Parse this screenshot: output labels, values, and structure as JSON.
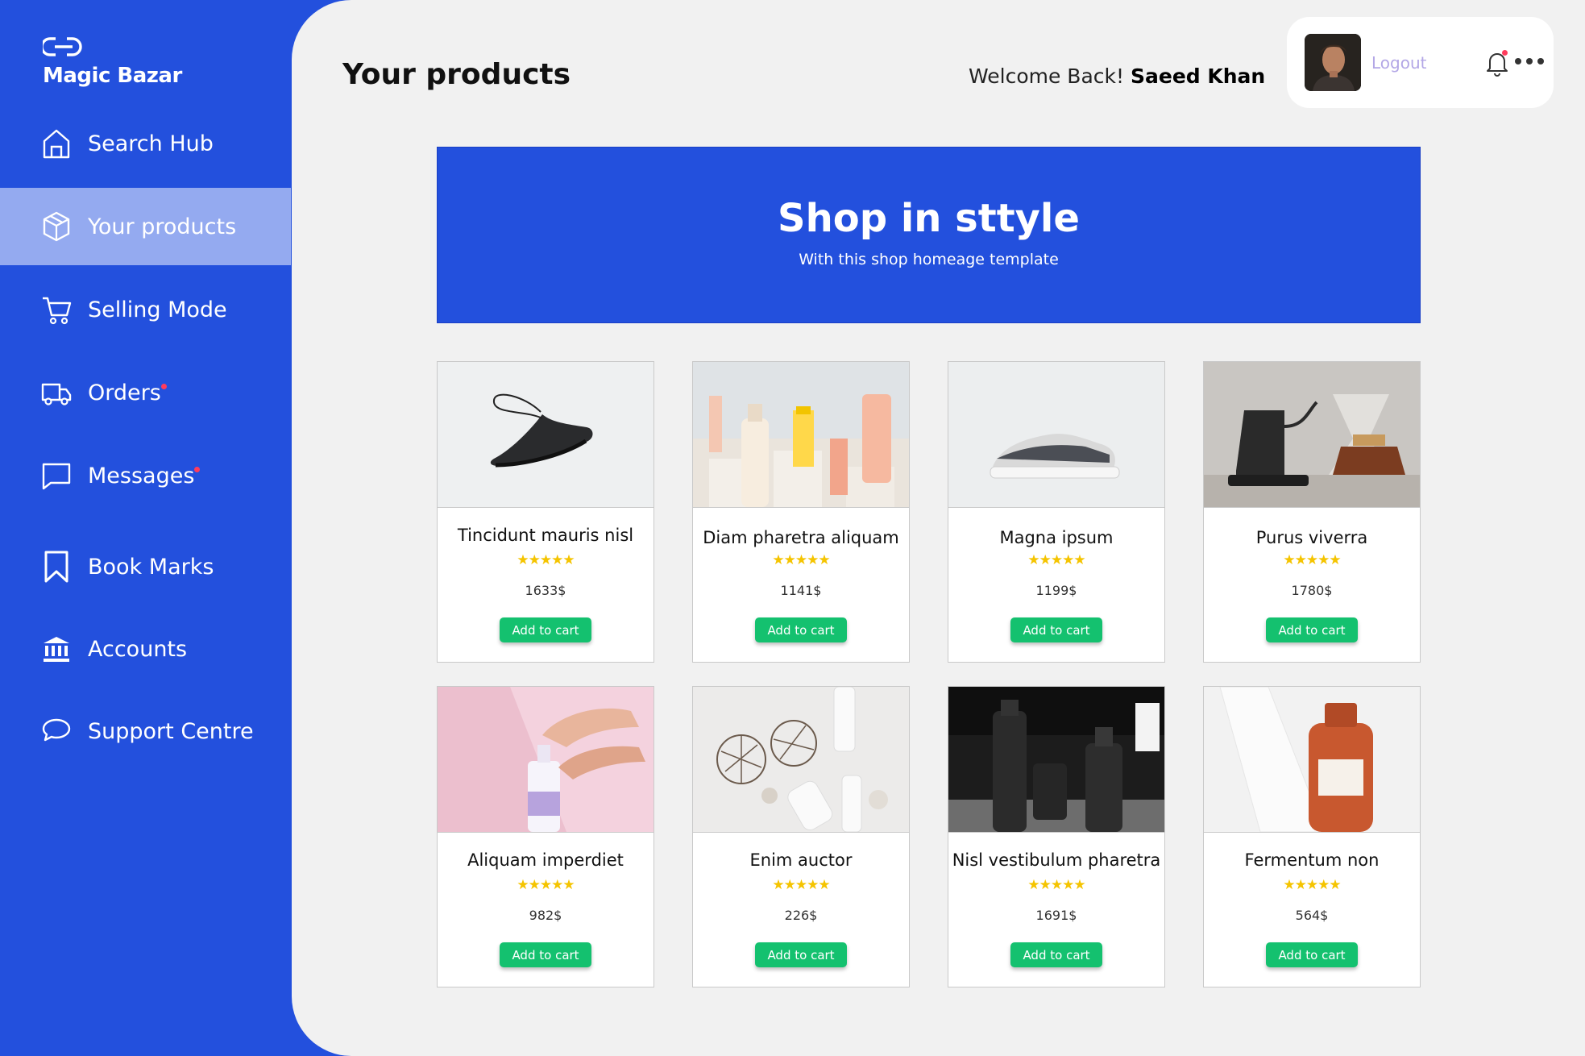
{
  "brand": {
    "name": "Magic Bazar",
    "logo_icon": "link-logo-icon"
  },
  "sidebar": {
    "items": [
      {
        "label": "Search Hub",
        "icon": "home-icon",
        "active": false,
        "notification": false
      },
      {
        "label": "Your products",
        "icon": "box-icon",
        "active": true,
        "notification": false
      },
      {
        "label": "Selling Mode",
        "icon": "cart-icon",
        "active": false,
        "notification": false
      },
      {
        "label": "Orders",
        "icon": "truck-icon",
        "active": false,
        "notification": true
      },
      {
        "label": "Messages",
        "icon": "message-icon",
        "active": false,
        "notification": true
      },
      {
        "label": "Book Marks",
        "icon": "bookmark-icon",
        "active": false,
        "notification": false
      },
      {
        "label": "Accounts",
        "icon": "bank-icon",
        "active": false,
        "notification": false
      },
      {
        "label": "Support Centre",
        "icon": "chat-bubble-icon",
        "active": false,
        "notification": false
      }
    ]
  },
  "header": {
    "title": "Your products",
    "welcome_prefix": "Welcome Back!",
    "user_name": "Saeed Khan",
    "logout_label": "Logout",
    "has_notification": true
  },
  "hero": {
    "title": "Shop in sttyle",
    "subtitle": "With this shop homeage template"
  },
  "products": [
    {
      "name": "Tincidunt mauris nisl",
      "price": "1633$",
      "rating": 5,
      "stars": "★★★★★",
      "button": "Add to cart",
      "image": "sneaker-black-photo"
    },
    {
      "name": "Diam pharetra aliquam",
      "price": "1141$",
      "rating": 5,
      "stars": "★★★★★",
      "button": "Add to cart",
      "image": "skincare-bottles-photo"
    },
    {
      "name": "Magna ipsum",
      "price": "1199$",
      "rating": 5,
      "stars": "★★★★★",
      "button": "Add to cart",
      "image": "sneaker-grey-photo"
    },
    {
      "name": "Purus viverra",
      "price": "1780$",
      "rating": 5,
      "stars": "★★★★★",
      "button": "Add to cart",
      "image": "kettle-coffee-photo"
    },
    {
      "name": "Aliquam imperdiet",
      "price": "982$",
      "rating": 5,
      "stars": "★★★★★",
      "button": "Add to cart",
      "image": "hand-lotion-photo"
    },
    {
      "name": "Enim auctor",
      "price": "226$",
      "rating": 5,
      "stars": "★★★★★",
      "button": "Add to cart",
      "image": "cosmetics-flatlay-photo"
    },
    {
      "name": "Nisl vestibulum pharetra",
      "price": "1691$",
      "rating": 5,
      "stars": "★★★★★",
      "button": "Add to cart",
      "image": "black-bottles-photo"
    },
    {
      "name": "Fermentum non",
      "price": "564$",
      "rating": 5,
      "stars": "★★★★★",
      "button": "Add to cart",
      "image": "amber-oil-bottle-photo"
    }
  ],
  "colors": {
    "sidebar": "#2350dd",
    "sidebar_active": "#94aaf0",
    "content_bg": "#f1f1f1",
    "hero_bg": "#2350dd",
    "button": "#14c16f",
    "stars": "#f5c400",
    "notification": "#ff3b5c",
    "logout": "#b3a7e6"
  }
}
